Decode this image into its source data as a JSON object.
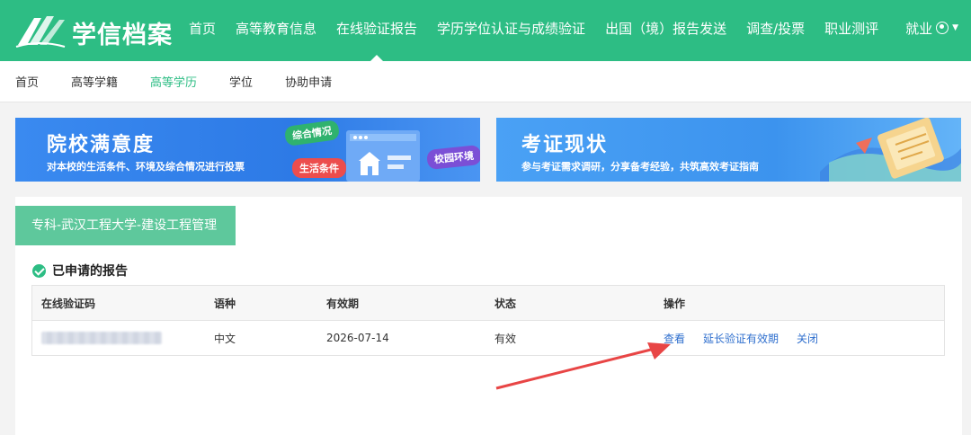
{
  "brand": {
    "logo_text": "学信档案",
    "accent": "#2dbd84"
  },
  "nav": {
    "items": [
      {
        "label": "首页",
        "active": false
      },
      {
        "label": "高等教育信息",
        "active": false
      },
      {
        "label": "在线验证报告",
        "active": true
      },
      {
        "label": "学历学位认证与成绩验证",
        "active": false
      },
      {
        "label": "出国（境）报告发送",
        "active": false
      },
      {
        "label": "调查/投票",
        "active": false
      },
      {
        "label": "职业测评",
        "active": false
      },
      {
        "label": "就业",
        "active": false
      }
    ],
    "user_icon": "user-circle-icon"
  },
  "subnav": {
    "items": [
      {
        "label": "首页",
        "active": false
      },
      {
        "label": "高等学籍",
        "active": false
      },
      {
        "label": "高等学历",
        "active": true
      },
      {
        "label": "学位",
        "active": false
      },
      {
        "label": "协助申请",
        "active": false
      }
    ]
  },
  "banners": [
    {
      "title": "院校满意度",
      "subtitle": "对本校的生活条件、环境及综合情况进行投票",
      "tags": [
        "综合情况",
        "生活条件",
        "校园环境"
      ]
    },
    {
      "title": "考证现状",
      "subtitle": "参与考证需求调研，分享备考经验，共筑高效考证指南"
    }
  ],
  "record": {
    "major_tab": "专科-武汉工程大学-建设工程管理",
    "section_title": "已申请的报告",
    "columns": [
      "在线验证码",
      "语种",
      "有效期",
      "状态",
      "操作"
    ],
    "rows": [
      {
        "code": "",
        "language": "中文",
        "valid_until": "2026-07-14",
        "status": "有效",
        "actions": [
          "查看",
          "延长验证有效期",
          "关闭"
        ]
      }
    ]
  },
  "annotation_color": "#e84545"
}
